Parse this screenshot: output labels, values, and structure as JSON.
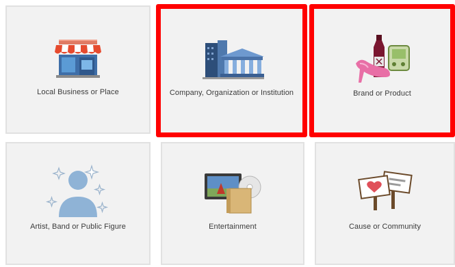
{
  "categories": [
    {
      "label": "Local Business or Place",
      "icon": "storefront-icon",
      "selected": false
    },
    {
      "label": "Company, Organization or Institution",
      "icon": "company-buildings-icon",
      "selected": true
    },
    {
      "label": "Brand or Product",
      "icon": "brand-products-icon",
      "selected": true
    },
    {
      "label": "Artist, Band or Public Figure",
      "icon": "artist-silhouette-icon",
      "selected": false
    },
    {
      "label": "Entertainment",
      "icon": "entertainment-media-icon",
      "selected": false
    },
    {
      "label": "Cause or Community",
      "icon": "cause-signs-icon",
      "selected": false
    }
  ],
  "colors": {
    "highlight": "#ff0000",
    "tile_bg": "#f2f2f2",
    "tile_border": "#e1e1e1"
  }
}
